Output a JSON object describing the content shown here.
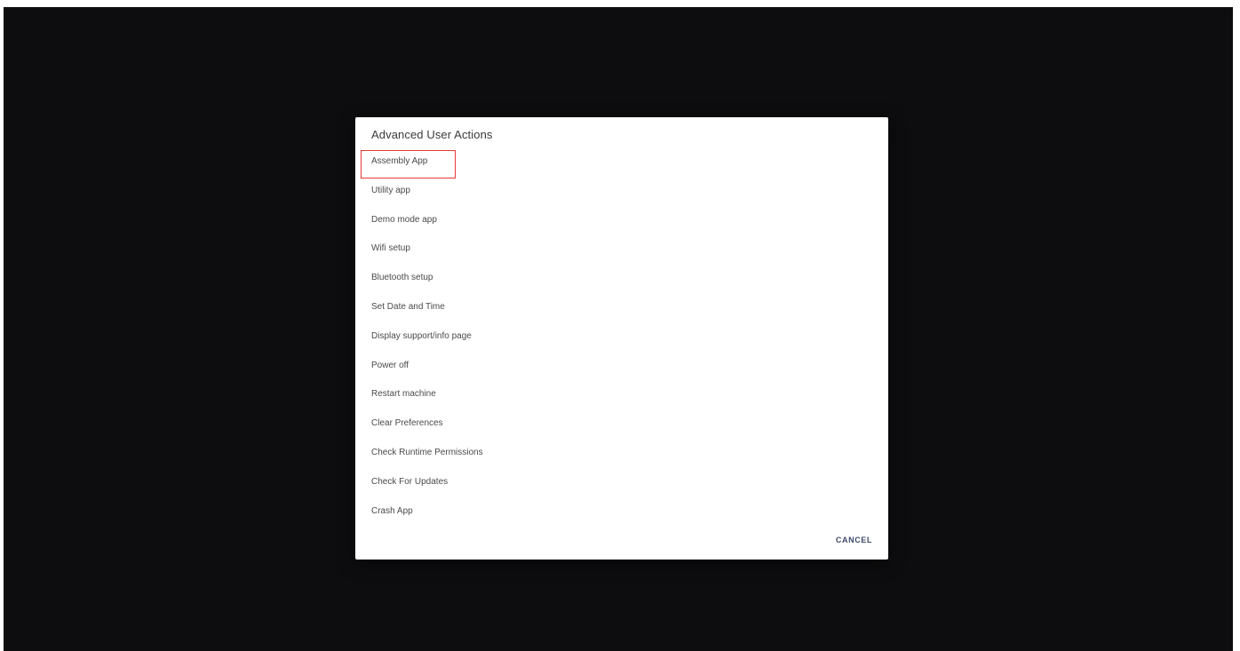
{
  "dialog": {
    "title": "Advanced User Actions",
    "actions": [
      "Assembly App",
      "Utility app",
      "Demo mode app",
      "Wifi setup",
      "Bluetooth setup",
      "Set Date and Time",
      "Display support/info page",
      "Power off",
      "Restart machine",
      "Clear Preferences",
      "Check Runtime Permissions",
      "Check For Updates",
      "Crash App"
    ],
    "highlighted_action": "Assembly App",
    "cancel_label": "CANCEL"
  },
  "colors": {
    "screen_background": "#0d0d0f",
    "dialog_background": "#ffffff",
    "highlight_border": "#e53935",
    "cancel_text": "#3f4a6b"
  }
}
